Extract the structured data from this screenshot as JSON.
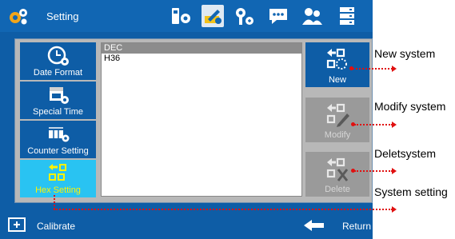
{
  "header": {
    "title": "Setting",
    "logo_icon": "gears-icon",
    "icons": [
      "device-settings-icon",
      "edit-settings-icon",
      "key-tool-icon",
      "message-icon",
      "users-icon",
      "server-icon"
    ],
    "active_icon": "edit-settings-icon"
  },
  "left_menu": [
    {
      "label": "Date Format",
      "icon": "clock-gear-icon",
      "selected": false
    },
    {
      "label": "Special Time",
      "icon": "calendar-gear-icon",
      "selected": false
    },
    {
      "label": "Counter Setting",
      "icon": "counter-gear-icon",
      "selected": false
    },
    {
      "label": "Hex Setting",
      "icon": "hex-arrows-icon",
      "selected": true
    }
  ],
  "system_list": {
    "items": [
      "DEC",
      "H36"
    ],
    "selected": "DEC"
  },
  "actions": {
    "new": {
      "label": "New",
      "enabled": true
    },
    "modify": {
      "label": "Modify",
      "enabled": false
    },
    "delete": {
      "label": "Delete",
      "enabled": false
    }
  },
  "footer": {
    "calibrate_label": "Calibrate",
    "return_label": "Return"
  },
  "annotations": {
    "new": "New system",
    "modify": "Modify system",
    "delete": "Deletsystem",
    "system": "System setting"
  },
  "colors": {
    "background": "#0e5da6",
    "selected_menu": "#29c3f2",
    "selected_text": "#fff200",
    "annotation": "#e01010"
  }
}
